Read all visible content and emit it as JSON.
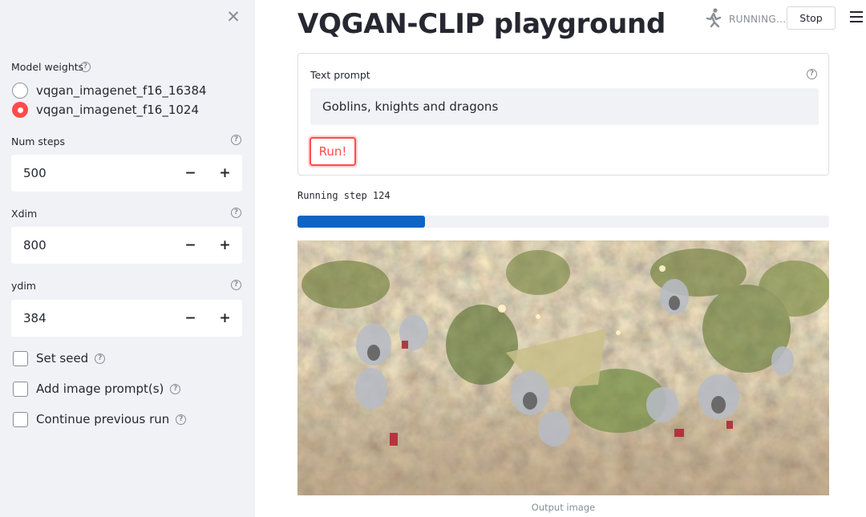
{
  "sidebar": {
    "close_icon": "close-icon",
    "model_weights": {
      "label": "Model weights",
      "options": [
        "vqgan_imagenet_f16_16384",
        "vqgan_imagenet_f16_1024"
      ],
      "selected": "vqgan_imagenet_f16_1024"
    },
    "num_steps": {
      "label": "Num steps",
      "value": "500"
    },
    "xdim": {
      "label": "Xdim",
      "value": "800"
    },
    "ydim": {
      "label": "ydim",
      "value": "384"
    },
    "stepper": {
      "minus": "−",
      "plus": "+"
    },
    "checkboxes": [
      {
        "label": "Set seed",
        "checked": false
      },
      {
        "label": "Add image prompt(s)",
        "checked": false
      },
      {
        "label": "Continue previous run",
        "checked": false
      }
    ],
    "help_glyph": "?"
  },
  "header": {
    "title": "VQGAN-CLIP playground",
    "status_text": "RUNNING...",
    "stop_label": "Stop",
    "menu_icon": "hamburger-menu-icon",
    "running_icon": "running-man-icon"
  },
  "form": {
    "prompt_label": "Text prompt",
    "prompt_value": "Goblins, knights and dragons",
    "run_label": "Run!"
  },
  "status": "Running step 124",
  "progress": 0.24,
  "output": {
    "caption": "Output image"
  },
  "colors": {
    "accent": "#ff4b4b",
    "progress": "#0e64c4",
    "sidebar_bg": "#f0f2f6"
  }
}
